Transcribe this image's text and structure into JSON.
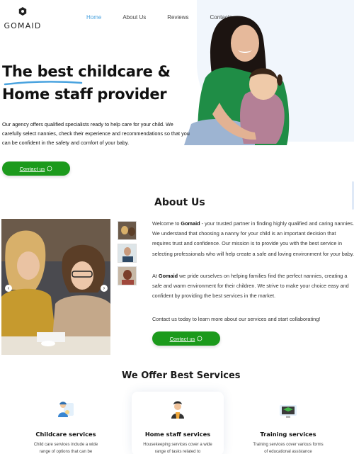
{
  "brand": {
    "name": "GOMAID"
  },
  "nav": {
    "items": [
      {
        "label": "Home"
      },
      {
        "label": "About Us"
      },
      {
        "label": "Reviews"
      },
      {
        "label": "Contacts"
      }
    ]
  },
  "hero": {
    "title_line1": "The best childcare &",
    "title_line2": "Home staff provider",
    "description": "Our agency offers qualified specialists ready to help care for your child. We carefully select nannies, check their experience and recommendations so that you can be confident in the safety and comfort of your baby.",
    "cta_label": "Contact us"
  },
  "about": {
    "title": "About Us",
    "p1_lead": "Welcome to ",
    "p1_brand": "Gomaid",
    "p1_rest": " - your trusted partner in finding highly qualified and caring nannies. We understand that choosing a nanny for your child is an important decision that requires trust and confidence. Our mission is to provide you with the best service in selecting professionals who will help create a safe and loving environment for your baby.",
    "p2_lead": "At ",
    "p2_brand": "Gomaid",
    "p2_rest": " we pride ourselves on helping families find the perfect nannies, creating a safe and warm environment for their children. We strive to make your choice easy and confident by providing the best services in the market.",
    "p3": "Contact us today to learn more about our services and start collaborating!",
    "cta_label": "Contact us",
    "prev_glyph": "‹",
    "next_glyph": "›"
  },
  "services": {
    "title": "We Offer Best Services",
    "items": [
      {
        "title": "Childcare services",
        "desc": "Child care services include a wide range of options that can be",
        "icon": "nanny-icon"
      },
      {
        "title": "Home staff services",
        "desc": "Housekeeping services cover a wide range of tasks related to",
        "icon": "housekeeper-icon"
      },
      {
        "title": "Training services",
        "desc": "Training services cover various forms of educational assistance",
        "icon": "training-icon"
      }
    ]
  },
  "colors": {
    "accent": "#4aa3df",
    "cta": "#1c9a1c",
    "hero_bg": "#f1f6fc"
  }
}
